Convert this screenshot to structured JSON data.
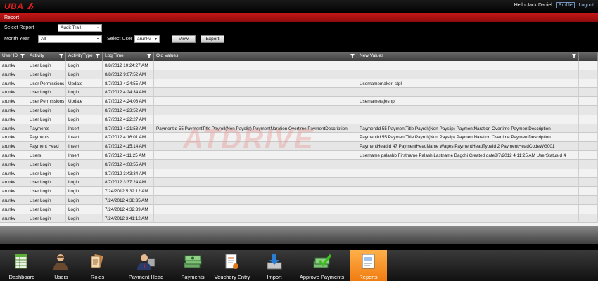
{
  "app": {
    "logo": "UBA"
  },
  "user": {
    "greeting": "Hello Jack Daniel",
    "profile": "Profile",
    "logout": "Logout"
  },
  "section": {
    "title": "Report"
  },
  "filters": {
    "select_report_label": "Select Report",
    "report_value": "Audit Trail",
    "month_year_label": "Month Year",
    "month_year_value": "All",
    "select_user_label": "Select User",
    "user_value": "arunkv",
    "view_button": "View",
    "export_button": "Export"
  },
  "table": {
    "columns": [
      "User ID",
      "Activity",
      "ActivityType",
      "Log Time",
      "Old Values",
      "New Values"
    ],
    "rows": [
      [
        "arunkv",
        "User Login",
        "Login",
        "8/8/2012 10:24:27 AM",
        "",
        ""
      ],
      [
        "arunkv",
        "User Login",
        "Login",
        "8/8/2012 9:07:52 AM",
        "",
        ""
      ],
      [
        "arunkv",
        "User Permissions",
        "Update",
        "8/7/2012 4:24:55 AM",
        "",
        "Usernamemaker_stpl"
      ],
      [
        "arunkv",
        "User Login",
        "Login",
        "8/7/2012 4:24:34 AM",
        "",
        ""
      ],
      [
        "arunkv",
        "User Permissions",
        "Update",
        "8/7/2012 4:24:08 AM",
        "",
        "Usernamerajeshp"
      ],
      [
        "arunkv",
        "User Login",
        "Login",
        "8/7/2012 4:23:52 AM",
        "",
        ""
      ],
      [
        "arunkv",
        "User Login",
        "Login",
        "8/7/2012 4:22:27 AM",
        "",
        ""
      ],
      [
        "arunkv",
        "Payments",
        "Insert",
        "8/7/2012 4:21:53 AM",
        "PaymentId 55 PaymentTitle Payroll(Non Payslip) PaymentNaration Overtime PaymentDescription",
        "PaymentId 55 PaymentTitle Payroll(Non Payslip) PaymentNaration Overtime PaymentDescription"
      ],
      [
        "arunkv",
        "Payments",
        "Insert",
        "8/7/2012 4:16:01 AM",
        "",
        "PaymentId 55 PaymentTitle Payroll(Non Payslip) PaymentNaration Overtime PaymentDescription"
      ],
      [
        "arunkv",
        "Payment Head",
        "Insert",
        "8/7/2012 4:15:14 AM",
        "",
        "PaymentHeadId 47 PaymentHeadName Wages PaymentHeadTypeId 2 PaymentHeadCodeWG001"
      ],
      [
        "arunkv",
        "Users",
        "Insert",
        "8/7/2012 4:11:25 AM",
        "",
        "Username palashb Firstname Palash Lastname Bagchi Created date8/7/2012 4:11:25 AM UserStatusId 4"
      ],
      [
        "arunkv",
        "User Login",
        "Login",
        "8/7/2012 4:08:55 AM",
        "",
        ""
      ],
      [
        "arunkv",
        "User Login",
        "Login",
        "8/7/2012 3:43:34 AM",
        "",
        ""
      ],
      [
        "arunkv",
        "User Login",
        "Login",
        "8/7/2012 3:37:24 AM",
        "",
        ""
      ],
      [
        "arunkv",
        "User Login",
        "Login",
        "7/24/2012 5:32:12 AM",
        "",
        ""
      ],
      [
        "arunkv",
        "User Login",
        "Login",
        "7/24/2012 4:38:35 AM",
        "",
        ""
      ],
      [
        "arunkv",
        "User Login",
        "Login",
        "7/24/2012 4:32:39 AM",
        "",
        ""
      ],
      [
        "arunkv",
        "User Login",
        "Login",
        "7/24/2012 3:41:12 AM",
        "",
        ""
      ]
    ]
  },
  "watermark": "ATDRIVE",
  "dock": [
    {
      "label": "Dashboard",
      "icon": "spreadsheet-icon"
    },
    {
      "label": "Users",
      "icon": "user-icon"
    },
    {
      "label": "Roles",
      "icon": "documents-icon"
    },
    {
      "label": "Payment Head",
      "icon": "manager-icon"
    },
    {
      "label": "Payments",
      "icon": "money-stack-icon"
    },
    {
      "label": "Vouchery Entry",
      "icon": "voucher-icon"
    },
    {
      "label": "Import",
      "icon": "import-icon"
    },
    {
      "label": "Approve Payments",
      "icon": "approve-money-icon"
    },
    {
      "label": "Reports",
      "icon": "report-icon"
    }
  ],
  "colors": {
    "brand_red": "#c41616",
    "active_tab": "#f59a2c",
    "link": "#9fc3ee"
  }
}
